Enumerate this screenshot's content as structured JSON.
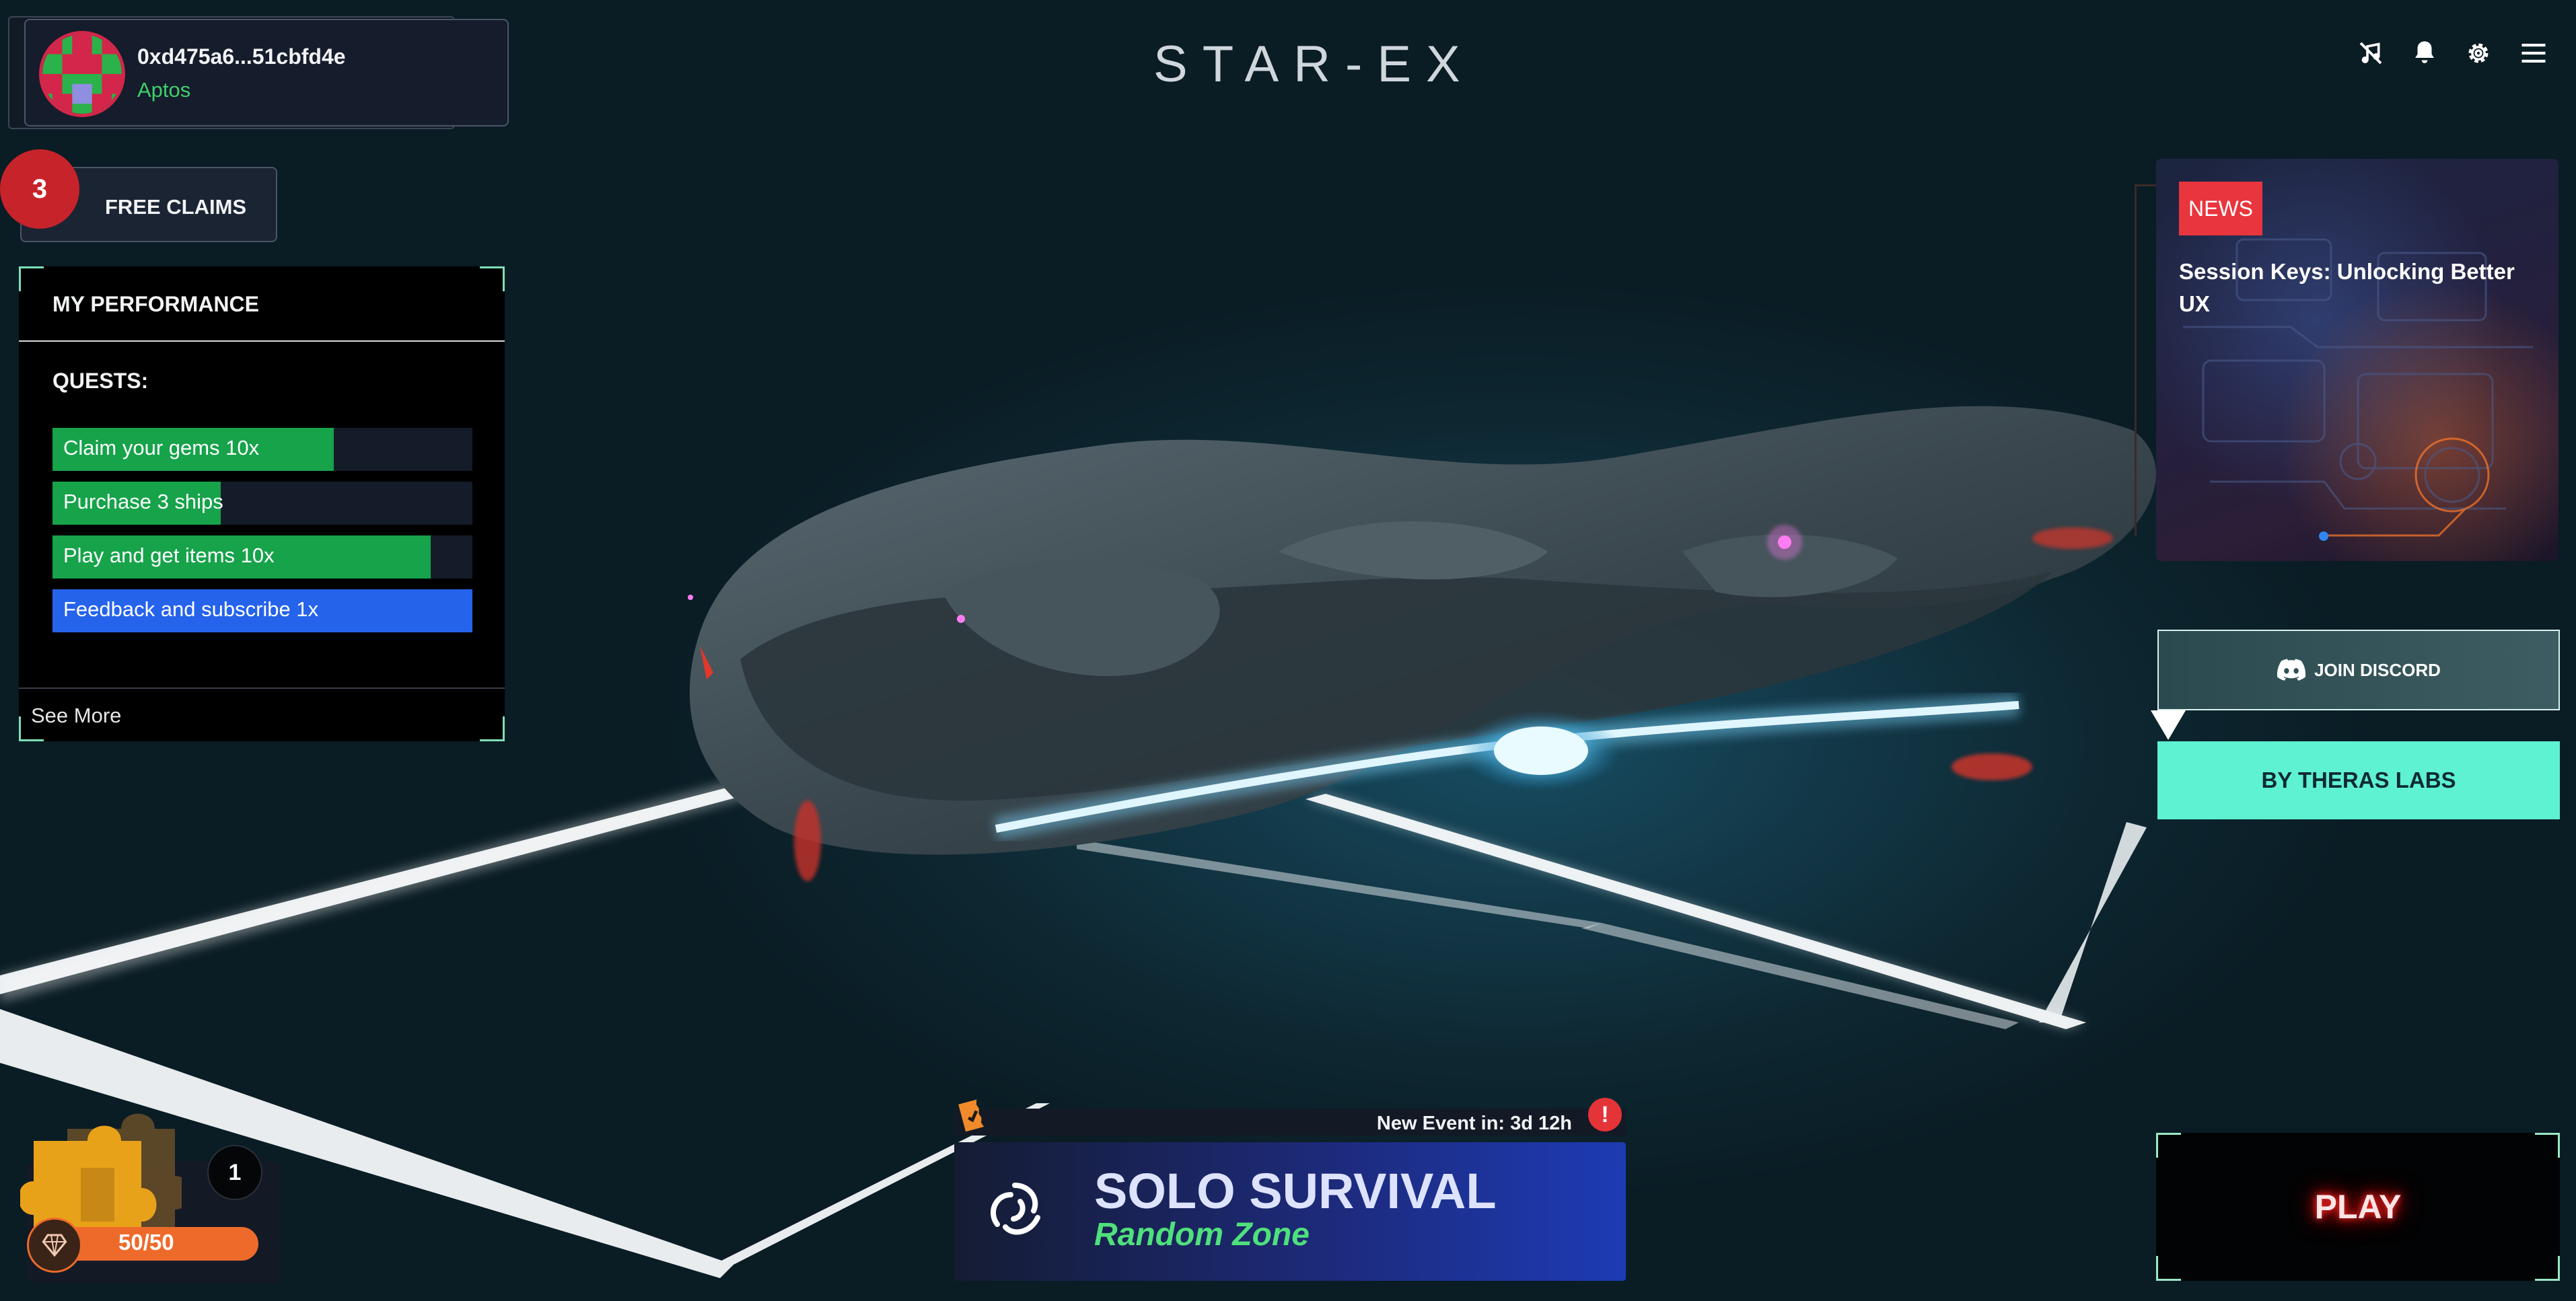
{
  "app": {
    "title": "STAR-EX"
  },
  "wallet": {
    "address": "0xd475a6...51cbfd4e",
    "network": "Aptos"
  },
  "top_icons": [
    "mute-icon",
    "bell-icon",
    "gear-icon",
    "menu-icon"
  ],
  "claims": {
    "label": "FREE CLAIMS",
    "count": "3"
  },
  "performance": {
    "title": "MY PERFORMANCE",
    "quests_label": "QUESTS:",
    "quests": [
      {
        "label": "Claim your gems 10x",
        "progress": 0.67,
        "color": "#16a34a"
      },
      {
        "label": "Purchase 3 ships",
        "progress": 0.4,
        "color": "#16a34a"
      },
      {
        "label": "Play and get items 10x",
        "progress": 0.9,
        "color": "#16a34a"
      },
      {
        "label": "Feedback and subscribe 1x",
        "progress": 1.0,
        "color": "#2563eb"
      }
    ],
    "see_more": "See More"
  },
  "news": {
    "badge": "NEWS",
    "title": "Session Keys: Unlocking Better UX"
  },
  "discord": {
    "label": "JOIN DISCORD"
  },
  "theras": {
    "label": "BY THERAS LABS"
  },
  "play": {
    "label": "PLAY"
  },
  "event": {
    "countdown": "New Event in: 3d 12h",
    "alert": "!",
    "mode": "SOLO SURVIVAL",
    "zone": "Random Zone"
  },
  "items": {
    "count": "1",
    "energy_text": "50/50",
    "energy_progress": 1.0
  },
  "colors": {
    "accent_teal": "#5ff2d2",
    "news_red": "#e9353d",
    "zone_green": "#4fe07c",
    "energy_orange": "#ee6a2a",
    "badge_red": "#c7232b"
  }
}
